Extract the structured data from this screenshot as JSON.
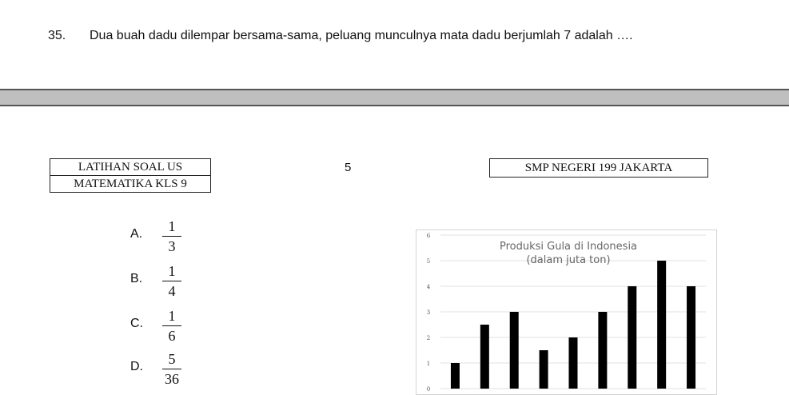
{
  "question": {
    "number": "35.",
    "text": "Dua buah dadu dilempar bersama-sama, peluang munculnya mata dadu berjumlah 7 adalah …."
  },
  "header": {
    "left_line1": "LATIHAN SOAL US",
    "left_line2": "MATEMATIKA KLS 9",
    "page_number": "5",
    "school": "SMP NEGERI 199 JAKARTA"
  },
  "options": [
    {
      "letter": "A.",
      "numerator": "1",
      "denominator": "3"
    },
    {
      "letter": "B.",
      "numerator": "1",
      "denominator": "4"
    },
    {
      "letter": "C.",
      "numerator": "1",
      "denominator": "6"
    },
    {
      "letter": "D.",
      "numerator": "5",
      "denominator": "36"
    }
  ],
  "chart_data": {
    "type": "bar",
    "title": "Produksi Gula di Indonesia",
    "subtitle": "(dalam juta ton)",
    "yticks": [
      "0",
      "1",
      "2",
      "3",
      "4",
      "5",
      "6"
    ],
    "ylim": [
      0,
      6
    ],
    "grid": true,
    "bar_color": "#000000",
    "values": [
      1,
      2.5,
      3,
      1.5,
      2,
      3,
      4,
      5,
      4
    ]
  }
}
